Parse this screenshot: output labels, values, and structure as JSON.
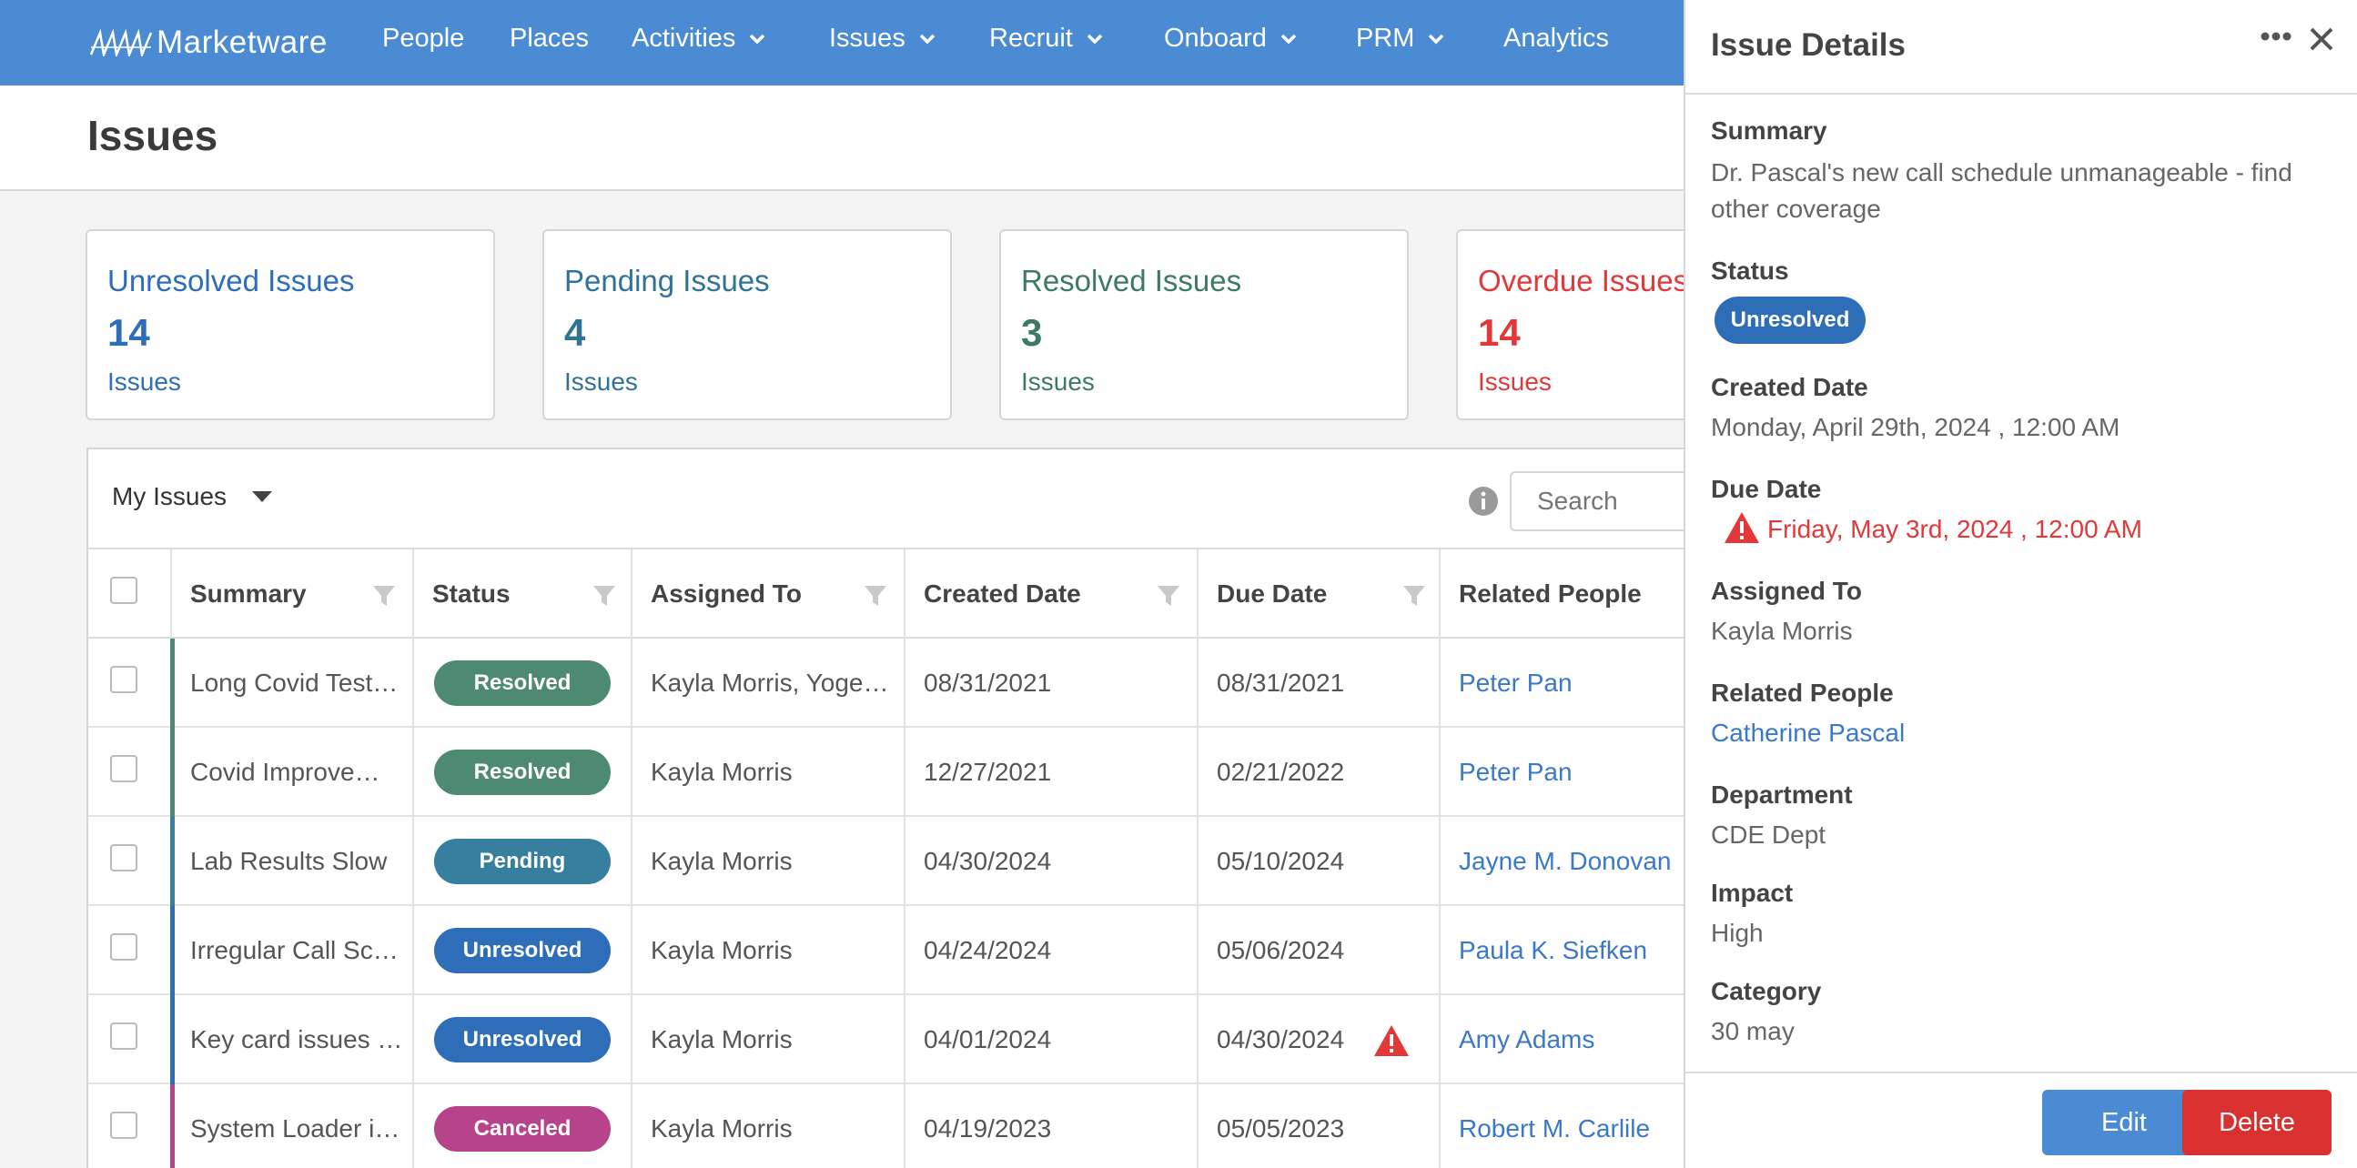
{
  "nav": {
    "logo": "Marketware",
    "items": [
      {
        "label": "People",
        "dropdown": false
      },
      {
        "label": "Places",
        "dropdown": false
      },
      {
        "label": "Activities",
        "dropdown": true
      },
      {
        "label": "Issues",
        "dropdown": true
      },
      {
        "label": "Recruit",
        "dropdown": true
      },
      {
        "label": "Onboard",
        "dropdown": true
      },
      {
        "label": "PRM",
        "dropdown": true
      },
      {
        "label": "Analytics",
        "dropdown": false
      }
    ]
  },
  "page": {
    "title": "Issues"
  },
  "cards": [
    {
      "title": "Unresolved Issues",
      "count": "14",
      "unit": "Issues",
      "color": "#2e6db8"
    },
    {
      "title": "Pending Issues",
      "count": "4",
      "unit": "Issues",
      "color": "#2f7396"
    },
    {
      "title": "Resolved Issues",
      "count": "3",
      "unit": "Issues",
      "color": "#3d7a66"
    },
    {
      "title": "Overdue Issues",
      "count": "14",
      "unit": "Issues",
      "color": "#e2383a"
    }
  ],
  "toolbar": {
    "view": "My Issues",
    "search_placeholder": "Search"
  },
  "table": {
    "headers": [
      "Summary",
      "Status",
      "Assigned To",
      "Created Date",
      "Due Date",
      "Related People"
    ],
    "rows": [
      {
        "summary": "Long Covid Test…",
        "status": "Resolved",
        "assigned": "Kayla Morris, Yoge…",
        "created": "08/31/2021",
        "due": "08/31/2021",
        "related": "Peter Pan",
        "overdue": false
      },
      {
        "summary": "Covid Improve…",
        "status": "Resolved",
        "assigned": "Kayla Morris",
        "created": "12/27/2021",
        "due": "02/21/2022",
        "related": "Peter Pan",
        "overdue": false
      },
      {
        "summary": "Lab Results Slow",
        "status": "Pending",
        "assigned": "Kayla Morris",
        "created": "04/30/2024",
        "due": "05/10/2024",
        "related": "Jayne M. Donovan",
        "overdue": false
      },
      {
        "summary": "Irregular Call Sc…",
        "status": "Unresolved",
        "assigned": "Kayla Morris",
        "created": "04/24/2024",
        "due": "05/06/2024",
        "related": "Paula K. Siefken",
        "overdue": false
      },
      {
        "summary": "Key card issues …",
        "status": "Unresolved",
        "assigned": "Kayla Morris",
        "created": "04/01/2024",
        "due": "04/30/2024",
        "related": "Amy Adams",
        "overdue": true
      },
      {
        "summary": "System Loader i…",
        "status": "Canceled",
        "assigned": "Kayla Morris",
        "created": "04/19/2023",
        "due": "05/05/2023",
        "related": "Robert M. Carlile",
        "overdue": false
      }
    ]
  },
  "status_colors": {
    "Resolved": "#4e8a72",
    "Pending": "#367f9e",
    "Unresolved": "#2e6db8",
    "Canceled": "#b7438a"
  },
  "details": {
    "title": "Issue Details",
    "summary_label": "Summary",
    "summary": "Dr. Pascal's new call schedule unmanageable - find other coverage",
    "status_label": "Status",
    "status": "Unresolved",
    "created_label": "Created Date",
    "created": "Monday, April 29th, 2024 , 12:00 AM",
    "due_label": "Due Date",
    "due": "Friday, May 3rd, 2024 , 12:00 AM",
    "assigned_label": "Assigned To",
    "assigned": "Kayla Morris",
    "related_label": "Related People",
    "related": "Catherine Pascal",
    "department_label": "Department",
    "department": "CDE Dept",
    "impact_label": "Impact",
    "impact": "High",
    "category_label": "Category",
    "category": "30 may",
    "edit_label": "Edit",
    "delete_label": "Delete"
  }
}
